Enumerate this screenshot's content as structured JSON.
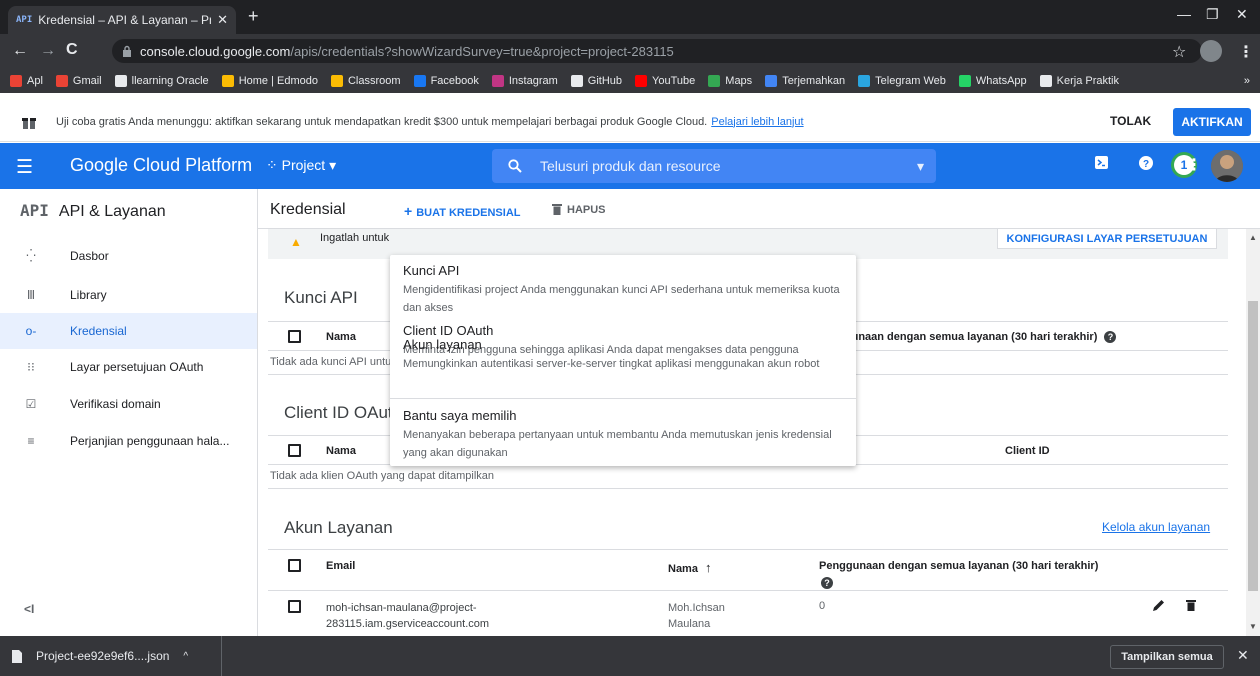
{
  "browser": {
    "tab_favicon": "API",
    "tab_title": "Kredensial – API & Layanan – Pro",
    "url_host": "console.cloud.google.com",
    "url_path": "/apis/credentials?showWizardSurvey=true&project=project-283115",
    "bookmarks": [
      {
        "label": "Apl",
        "color": "#ea4335"
      },
      {
        "label": "Gmail",
        "color": "#ea4335"
      },
      {
        "label": "llearning Oracle",
        "color": "#e8eaed"
      },
      {
        "label": "Home | Edmodo",
        "color": "#fbbc04"
      },
      {
        "label": "Classroom",
        "color": "#fbbc04"
      },
      {
        "label": "Facebook",
        "color": "#1877f2"
      },
      {
        "label": "Instagram",
        "color": "#c13584"
      },
      {
        "label": "GitHub",
        "color": "#e8eaed"
      },
      {
        "label": "YouTube",
        "color": "#ff0000"
      },
      {
        "label": "Maps",
        "color": "#34a853"
      },
      {
        "label": "Terjemahkan",
        "color": "#4285f4"
      },
      {
        "label": "Telegram Web",
        "color": "#2aa5e0"
      },
      {
        "label": "WhatsApp",
        "color": "#25d366"
      },
      {
        "label": "Kerja Praktik",
        "color": "#e8eaed"
      }
    ],
    "bookmarks_more": "»"
  },
  "trial": {
    "text": "Uji coba gratis Anda menunggu: aktifkan sekarang untuk mendapatkan kredit $300 untuk mempelajari berbagai produk Google Cloud.",
    "link": "Pelajari lebih lanjut",
    "dismiss": "TOLAK",
    "activate": "AKTIFKAN"
  },
  "header": {
    "title": "Google Cloud Platform",
    "project": "Project",
    "search_placeholder": "Telusuri produk dan resource",
    "notifications": "1"
  },
  "sidebar": {
    "title_mark": "API",
    "title": "API & Layanan",
    "items": [
      {
        "label": "Dasbor",
        "icon": "dashboard-icon"
      },
      {
        "label": "Library",
        "icon": "library-icon"
      },
      {
        "label": "Kredensial",
        "icon": "key-icon"
      },
      {
        "label": "Layar persetujuan OAuth",
        "icon": "consent-icon"
      },
      {
        "label": "Verifikasi domain",
        "icon": "domain-icon"
      },
      {
        "label": "Perjanjian penggunaan hala...",
        "icon": "agreement-icon"
      }
    ],
    "collapse": "<I"
  },
  "toolbar": {
    "title": "Kredensial",
    "create": "BUAT KREDENSIAL",
    "delete": "HAPUS"
  },
  "main": {
    "warning_text": "Ingatlah untuk",
    "configure_button": "KONFIGURASI LAYAR PERSETUJUAN",
    "api_keys": {
      "title": "Kunci API",
      "col_name": "Nama",
      "col_usage": "Penggunaan dengan semua layanan (30 hari terakhir)",
      "empty": "Tidak ada kunci API untuk ditampilkan"
    },
    "oauth": {
      "title": "Client ID OAuth",
      "col_name": "Nama",
      "col_client": "Client ID",
      "empty": "Tidak ada klien OAuth yang dapat ditampilkan"
    },
    "service_accounts": {
      "title": "Akun Layanan",
      "manage_link": "Kelola akun layanan",
      "col_email": "Email",
      "col_name": "Nama",
      "col_usage": "Penggunaan dengan semua layanan (30 hari terakhir)",
      "rows": [
        {
          "email_line1": "moh-ichsan-maulana@project-",
          "email_line2": "283115.iam.gserviceaccount.com",
          "name_line1": "Moh.Ichsan",
          "name_line2": "Maulana",
          "usage": "0"
        }
      ]
    }
  },
  "dropdown": {
    "items": [
      {
        "title": "Kunci API",
        "desc": "Mengidentifikasi project Anda menggunakan kunci API sederhana untuk memeriksa kuota dan akses"
      },
      {
        "title": "Client ID OAuth",
        "desc": "Meminta izin pengguna sehingga aplikasi Anda dapat mengakses data pengguna"
      },
      {
        "title": "Akun layanan",
        "desc": "Memungkinkan autentikasi server-ke-server tingkat aplikasi menggunakan akun robot"
      },
      {
        "title": "Bantu saya memilih",
        "desc": "Menanyakan beberapa pertanyaan untuk membantu Anda memutuskan jenis kredensial yang akan digunakan"
      }
    ]
  },
  "downloads": {
    "file": "Project-ee92e9ef6....json",
    "show_all": "Tampilkan semua"
  },
  "colors": {
    "brand_blue": "#1a73e8",
    "chrome_dark": "#202124"
  }
}
